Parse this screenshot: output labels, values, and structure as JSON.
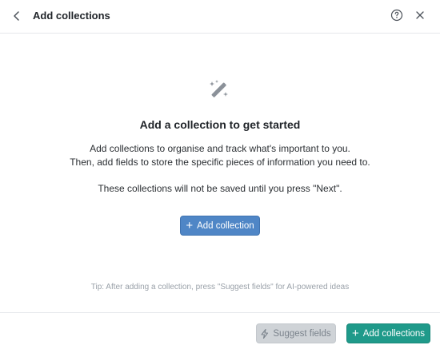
{
  "header": {
    "title": "Add collections",
    "back_icon": "chevron-left-icon",
    "help_icon": "question-circle-icon",
    "close_icon": "close-icon"
  },
  "empty_state": {
    "icon": "magic-wand-icon",
    "heading": "Add a collection to get started",
    "description_line1": "Add collections to organise and track what's important to you.",
    "description_line2": "Then, add fields to store the specific pieces of information you need to.",
    "notice": "These collections will not be saved until you press \"Next\".",
    "add_button_label": "Add collection",
    "tip": "Tip: After adding a collection, press \"Suggest fields\" for AI-powered ideas"
  },
  "footer": {
    "suggest_label": "Suggest fields",
    "suggest_icon": "lightning-icon",
    "add_label": "Add collections"
  },
  "colors": {
    "primary_blue": "#4f86c6",
    "teal": "#1f9a8a",
    "disabled": "#cfd3d7"
  }
}
